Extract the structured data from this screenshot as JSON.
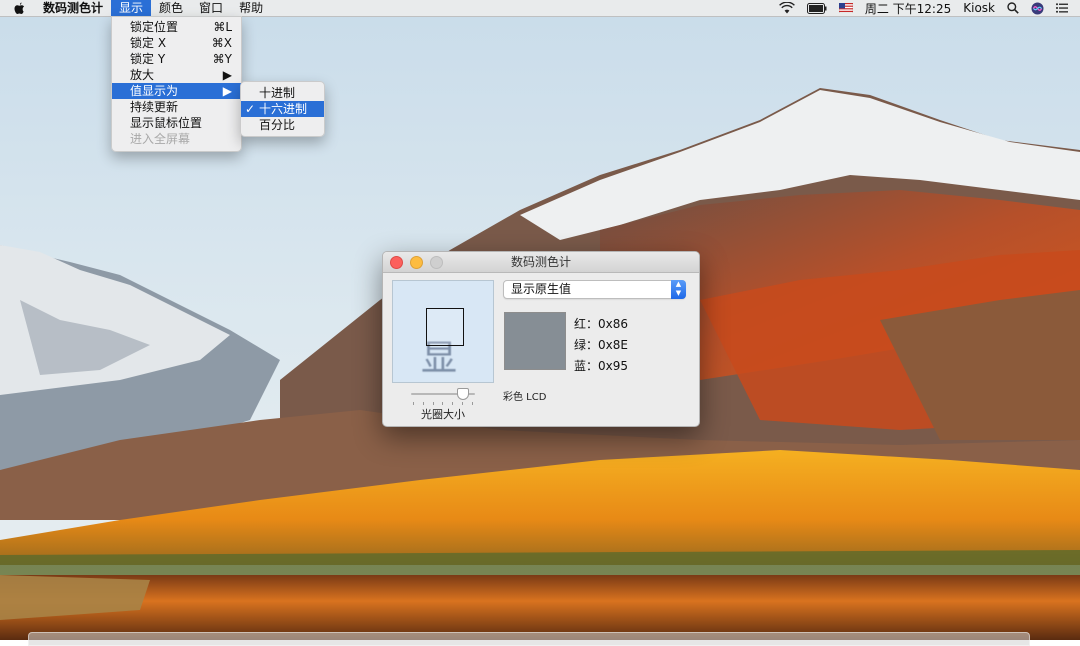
{
  "menubar": {
    "app_name": "数码测色计",
    "menus": [
      "显示",
      "颜色",
      "窗口",
      "帮助"
    ],
    "active_menu_index": 0,
    "status": {
      "clock": "周二 下午12:25",
      "user": "Kiosk",
      "input_flag": "US flag"
    }
  },
  "display_menu": {
    "items": [
      {
        "label": "锁定位置",
        "shortcut": "⌘L"
      },
      {
        "label": "锁定 X",
        "shortcut": "⌘X"
      },
      {
        "label": "锁定 Y",
        "shortcut": "⌘Y"
      },
      {
        "label": "放大",
        "shortcut": "▶"
      },
      {
        "label": "值显示为",
        "shortcut": "▶"
      },
      {
        "label": "持续更新",
        "shortcut": ""
      },
      {
        "label": "显示鼠标位置",
        "shortcut": ""
      },
      {
        "label": "进入全屏幕",
        "shortcut": ""
      }
    ],
    "highlighted_index": 4,
    "disabled_index": 7
  },
  "values_submenu": {
    "items": [
      "十进制",
      "十六进制",
      "百分比"
    ],
    "checked_index": 1,
    "check_mark": "✓"
  },
  "window": {
    "title": "数码测色计",
    "mode_popup": "显示原生值",
    "magnified_text": "显示",
    "aperture_label": "光圈大小",
    "aperture_level_fraction": 0.85,
    "swatch_color": "#868e95",
    "values": [
      {
        "label": "红：",
        "value": "0x86"
      },
      {
        "label": "绿：",
        "value": "0x8E"
      },
      {
        "label": "蓝：",
        "value": "0x95"
      }
    ],
    "profile": "彩色 LCD"
  },
  "colors": {
    "menu_highlight": "#2a6fd6",
    "close": "#fc605c",
    "minimize": "#fdbc40"
  }
}
